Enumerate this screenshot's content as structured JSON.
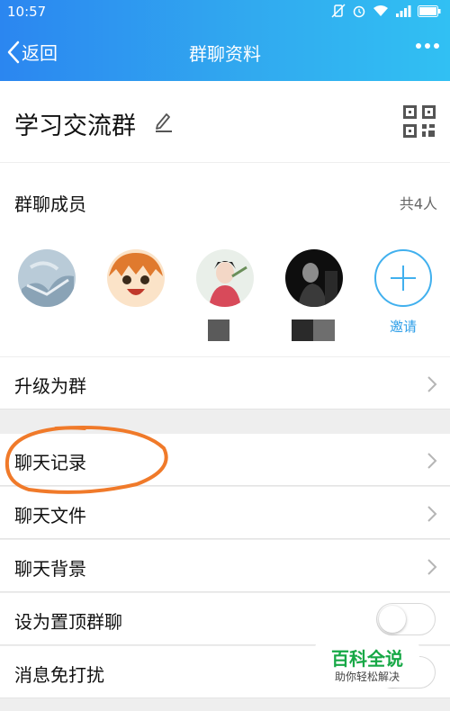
{
  "status_bar": {
    "time": "10:57"
  },
  "nav": {
    "back_label": "返回",
    "title": "群聊资料"
  },
  "group": {
    "name": "学习交流群"
  },
  "members": {
    "title": "群聊成员",
    "count_text": "共4人",
    "invite_label": "邀请"
  },
  "menu": {
    "upgrade": "升级为群",
    "chat_history": "聊天记录",
    "chat_files": "聊天文件",
    "chat_background": "聊天背景",
    "pin_chat": "设为置顶群聊",
    "mute": "消息免打扰"
  },
  "toggles": {
    "pin_chat_on": false,
    "mute_on": false
  },
  "watermark": {
    "title": "百科全说",
    "subtitle": "助你轻松解决"
  },
  "colors": {
    "header_start": "#2b86f0",
    "header_end": "#31c0f3",
    "accent": "#41b0ee",
    "annotation": "#f07a2a",
    "watermark": "#17a846"
  }
}
